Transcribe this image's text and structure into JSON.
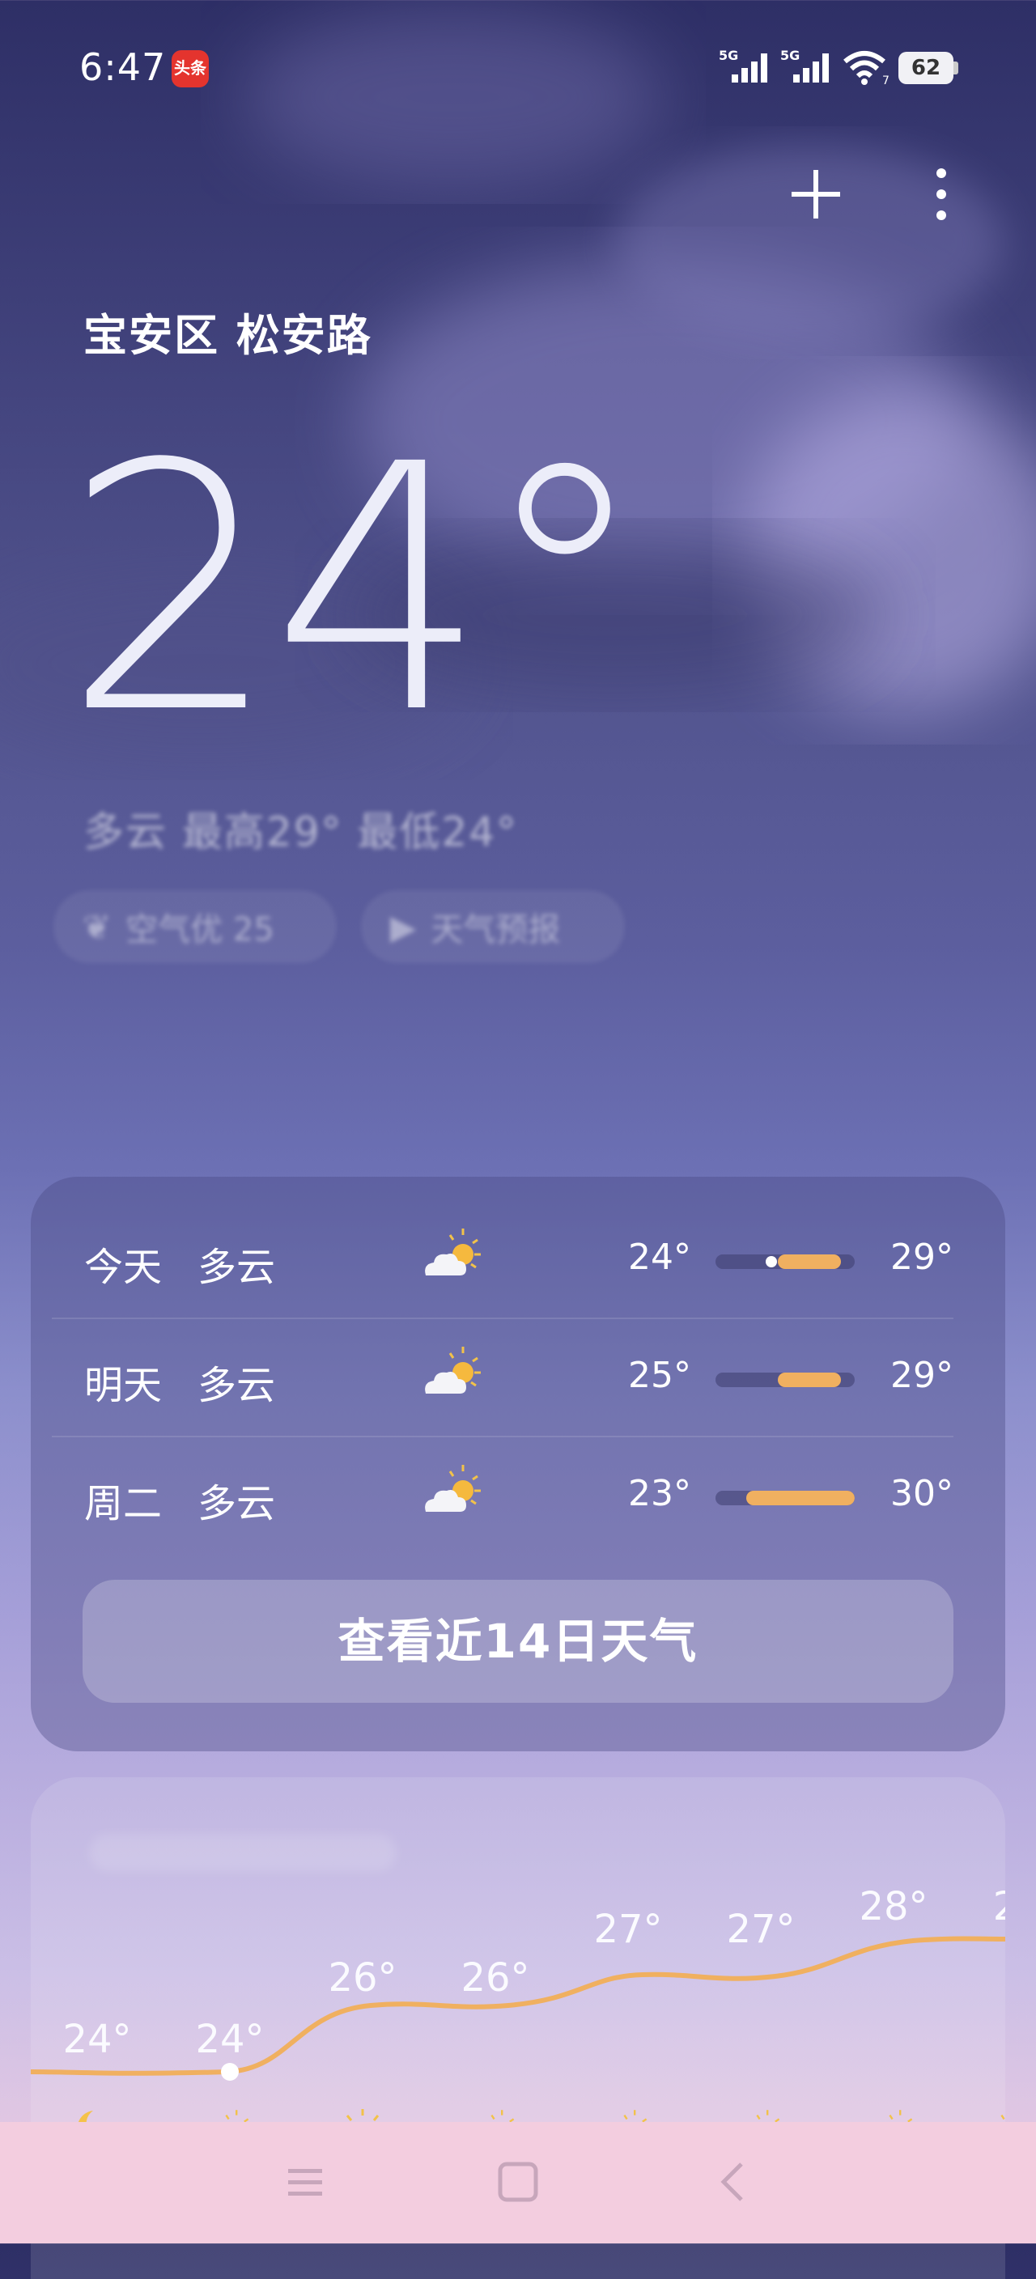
{
  "status_bar": {
    "time": "6:47",
    "app_badge": "头条",
    "sim1": "5G",
    "sim2": "5G",
    "wifi_sub": "7",
    "battery": "62"
  },
  "header": {
    "add_icon": "plus-icon",
    "more_icon": "more-vertical-icon"
  },
  "location": "宝安区 松安路",
  "current": {
    "temperature": "24°",
    "summary": "多云  最高29° 最低24°",
    "aqi_chip": "空气优 25",
    "report_chip": "天气预报"
  },
  "forecast": [
    {
      "day": "今天",
      "condition": "多云",
      "icon": "partly-cloudy-icon",
      "low": "24°",
      "high": "29°",
      "range_start": 0.45,
      "range_end": 0.9,
      "now": 0.4
    },
    {
      "day": "明天",
      "condition": "多云",
      "icon": "partly-cloudy-icon",
      "low": "25°",
      "high": "29°",
      "range_start": 0.45,
      "range_end": 0.9
    },
    {
      "day": "周二",
      "condition": "多云",
      "icon": "partly-cloudy-icon",
      "low": "23°",
      "high": "30°",
      "range_start": 0.22,
      "range_end": 1.0
    }
  ],
  "forecast_button": "查看近14日天气",
  "hourly": {
    "temps": [
      "24°",
      "24°",
      "26°",
      "26°",
      "27°",
      "27°",
      "28°",
      "2"
    ],
    "icons": [
      "moon-icon",
      "partly-cloudy-icon",
      "sun-icon",
      "partly-cloudy-icon",
      "partly-cloudy-icon",
      "partly-cloudy-icon",
      "partly-cloudy-icon",
      "partly-cloudy-icon"
    ],
    "line_color": "#f0b060"
  },
  "nav": {
    "menu_icon": "menu-icon",
    "home_icon": "home-icon",
    "back_icon": "back-icon"
  }
}
